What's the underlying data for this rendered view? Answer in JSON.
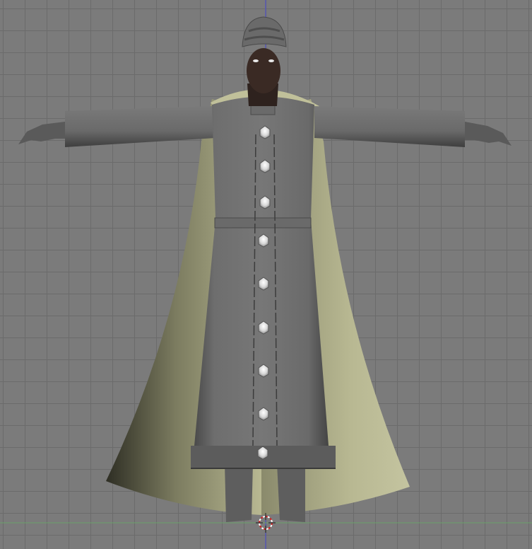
{
  "viewport": {
    "mode": "3d-viewport",
    "view": "front-orthographic",
    "subject": "character-mesh",
    "colors": {
      "background": "#7b7b7b",
      "grid_line": "#6b6b6b",
      "z_axis": "#4a4ad0",
      "x_axis": "#6aa06a",
      "cursor_red": "#d02020",
      "robe": "#6e6e6e",
      "cape": "#b4b48e",
      "skin": "#3a2a24"
    },
    "icons": [
      "3d-cursor-icon"
    ]
  }
}
